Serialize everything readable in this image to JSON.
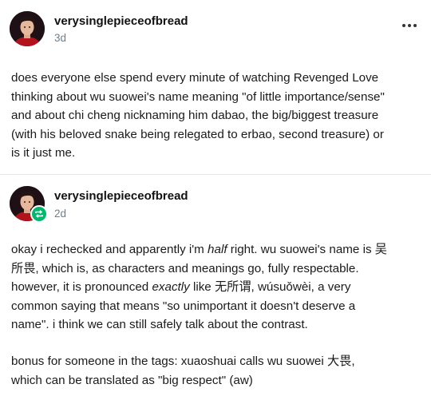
{
  "posts": [
    {
      "username": "verysinglepieceofbread",
      "timestamp": "3d",
      "lines": [
        "does everyone else spend every minute of watching Revenged Love",
        "thinking about wu suowei's name meaning \"of little importance/sense\"",
        "and about chi cheng nicknaming him dabao, the big/biggest treasure",
        "(with his beloved snake being relegated to erbao, second treasure) or",
        "is it just me."
      ]
    },
    {
      "username": "verysinglepieceofbread",
      "timestamp": "2d",
      "p1": {
        "l1_a": "okay i rechecked and apparently i'm ",
        "l1_em": "half",
        "l1_b": " right. wu suowei's name is 吴",
        "l2": "所畏, which is, as characters and meanings go, fully respectable.",
        "l3_a": "however, it is pronounced ",
        "l3_em": "exactly",
        "l3_b": " like 无所谓,  wúsuǒwèi, a very",
        "l4": "common saying that means \"so unimportant it doesn't deserve a",
        "l5": "name\". i think we can still safely talk about the contrast."
      },
      "p2": {
        "l1": "bonus for someone in the tags: xuaoshuai calls wu suowei 大畏,",
        "l2": "which can be translated as \"big respect\" (aw)"
      }
    }
  ],
  "icons": {
    "more": "more-options-icon",
    "reblog": "reblog-icon",
    "avatar": "avatar"
  },
  "colors": {
    "reblog_badge": "#00b86b",
    "timestamp": "#6b7f8f",
    "divider": "#e5e5e5"
  }
}
